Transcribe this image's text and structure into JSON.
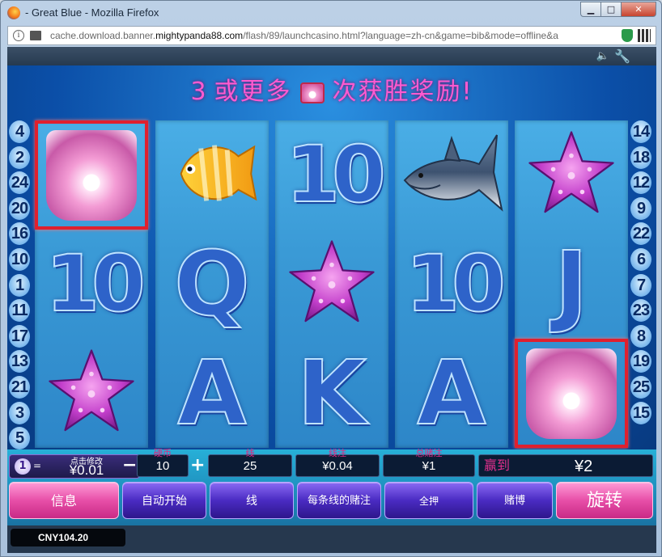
{
  "window": {
    "title": "- Great Blue - Mozilla Firefox",
    "url_prefix": "cache.download.banner.",
    "url_domain": "mightypanda88.com",
    "url_suffix": "/flash/89/launchcasino.html?language=zh-cn&game=bib&mode=offline&a"
  },
  "game": {
    "headline": {
      "number": "3",
      "before": "或更多",
      "after": "次获胜奖励!"
    },
    "lines_left": [
      "4",
      "2",
      "24",
      "20",
      "16",
      "10",
      "1",
      "11",
      "17",
      "13",
      "21",
      "3",
      "5"
    ],
    "lines_right": [
      "14",
      "18",
      "12",
      "9",
      "22",
      "6",
      "7",
      "23",
      "8",
      "19",
      "25",
      "15"
    ],
    "reels": [
      [
        {
          "symbol": "shell-icon",
          "win": true
        },
        {
          "symbol": "10",
          "win": false
        },
        {
          "symbol": "starfish-icon",
          "win": false
        }
      ],
      [
        {
          "symbol": "fish-icon",
          "win": false
        },
        {
          "symbol": "Q",
          "win": false
        },
        {
          "symbol": "A",
          "win": false
        }
      ],
      [
        {
          "symbol": "10",
          "win": false
        },
        {
          "symbol": "starfish-icon",
          "win": false
        },
        {
          "symbol": "K",
          "win": false
        }
      ],
      [
        {
          "symbol": "shark-icon",
          "win": false
        },
        {
          "symbol": "10",
          "win": false
        },
        {
          "symbol": "A",
          "win": false
        }
      ],
      [
        {
          "symbol": "starfish-icon",
          "win": false
        },
        {
          "symbol": "J",
          "win": false
        },
        {
          "symbol": "shell-icon",
          "win": true
        }
      ]
    ]
  },
  "panel": {
    "coin": {
      "index": "1",
      "eq": "=",
      "hint": "点击修改",
      "value": "¥0.01"
    },
    "coins_per_line": {
      "label": "硬币",
      "value": "10",
      "minus": "−",
      "plus": "+"
    },
    "lines": {
      "label": "线",
      "value": "25"
    },
    "line_bet": {
      "label": "线注",
      "value": "¥0.04"
    },
    "total_bet": {
      "label": "总赌注",
      "value": "¥1"
    },
    "win": {
      "label": "赢到",
      "value": "¥2"
    },
    "buttons": {
      "info": "信息",
      "autoplay": "自动开始",
      "lines": "线",
      "bet_per_line": "每条线的赌注",
      "max_bet": "全押",
      "gamble": "赌博",
      "spin": "旋转"
    },
    "balance": "CNY104.20"
  },
  "colors": {
    "accent": "#ff5ad0",
    "win_frame": "#e0202e",
    "button": "#4a2bc2"
  }
}
